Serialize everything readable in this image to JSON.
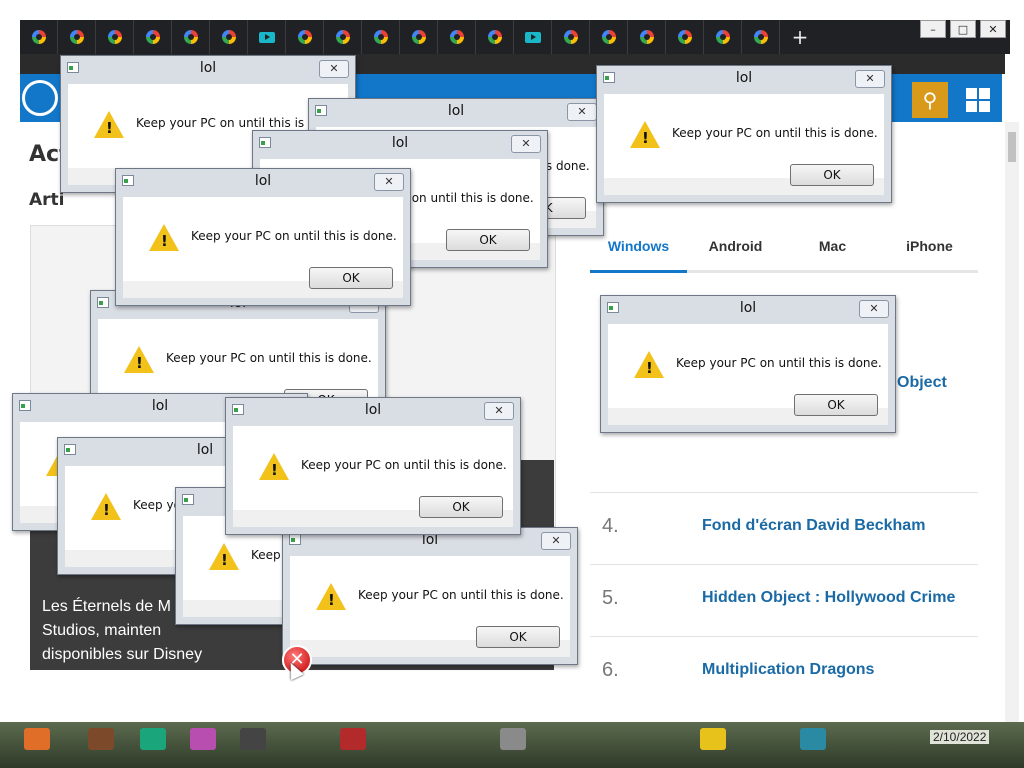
{
  "browser": {
    "tabs": [
      {
        "icon": "google-icon"
      },
      {
        "icon": "google-icon"
      },
      {
        "icon": "google-icon"
      },
      {
        "icon": "google-icon"
      },
      {
        "icon": "google-icon"
      },
      {
        "icon": "google-icon"
      },
      {
        "icon": "youtube-icon"
      },
      {
        "icon": "google-icon"
      },
      {
        "icon": "google-icon"
      },
      {
        "icon": "google-icon"
      },
      {
        "icon": "google-icon"
      },
      {
        "icon": "google-icon"
      },
      {
        "icon": "google-icon"
      },
      {
        "icon": "youtube-icon"
      },
      {
        "icon": "google-icon"
      },
      {
        "icon": "google-icon"
      },
      {
        "icon": "google-icon"
      },
      {
        "icon": "google-icon"
      },
      {
        "icon": "google-icon"
      },
      {
        "icon": "google-icon"
      }
    ],
    "new_tab_symbol": "+",
    "window_controls": {
      "minimize": "–",
      "maximize": "□",
      "close": "✕"
    }
  },
  "site": {
    "heading_partial": "Act",
    "subheading_partial": "Arti",
    "caption_lines": [
      "Les Éternels de M",
      "Studios, mainten",
      "disponibles sur Disney"
    ],
    "platform_tabs": [
      "Windows",
      "Android",
      "Mac",
      "iPhone"
    ],
    "active_tab": "Windows",
    "visible_object_text": "Object",
    "ranking": [
      {
        "rank": "4.",
        "title": "Fond d'écran David Beckham"
      },
      {
        "rank": "5.",
        "title": "Hidden Object : Hollywood Crime"
      },
      {
        "rank": "6.",
        "title": "Multiplication Dragons"
      }
    ]
  },
  "dialog": {
    "title": "lol",
    "message": "Keep your PC on until this is done.",
    "ok_label": "OK",
    "close_symbol": "✕",
    "warning_mark": "!"
  },
  "taskbar": {
    "date": "2/10/2022"
  },
  "colors": {
    "site_blue": "#1277c9",
    "accent_orange": "#d99a1c",
    "warning_yellow": "#f2c21b",
    "error_red": "#c40000"
  }
}
